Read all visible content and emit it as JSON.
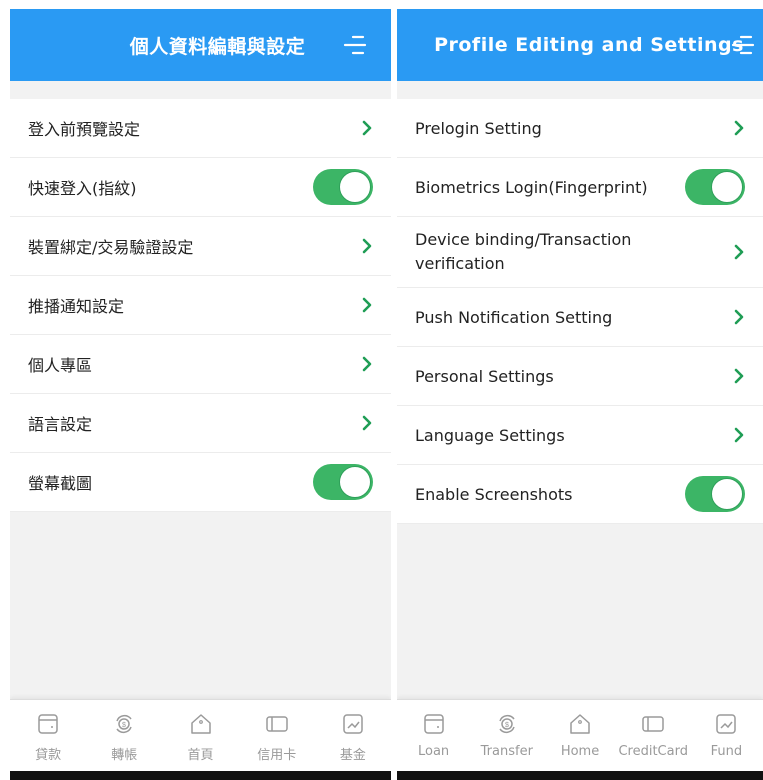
{
  "zh": {
    "header": {
      "title": "個人資料編輯與設定"
    },
    "rows": [
      {
        "label": "登入前預覽設定"
      },
      {
        "label": "快速登入(指紋)"
      },
      {
        "label": "裝置綁定/交易驗證設定"
      },
      {
        "label": "推播通知設定"
      },
      {
        "label": "個人專區"
      },
      {
        "label": "語言設定"
      },
      {
        "label": "螢幕截圖"
      }
    ],
    "tabs": [
      {
        "label": "貸款",
        "icon": "loan-icon"
      },
      {
        "label": "轉帳",
        "icon": "transfer-icon"
      },
      {
        "label": "首頁",
        "icon": "home-icon"
      },
      {
        "label": "信用卡",
        "icon": "credit-card-icon"
      },
      {
        "label": "基金",
        "icon": "fund-icon"
      }
    ]
  },
  "en": {
    "header": {
      "title": "Profile Editing and Settings"
    },
    "rows": [
      {
        "label": "Prelogin Setting"
      },
      {
        "label": "Biometrics Login(Fingerprint)"
      },
      {
        "label": "Device binding/Transaction verification"
      },
      {
        "label": "Push Notification Setting"
      },
      {
        "label": "Personal Settings"
      },
      {
        "label": "Language Settings"
      },
      {
        "label": "Enable Screenshots"
      }
    ],
    "tabs": [
      {
        "label": "Loan",
        "icon": "loan-icon"
      },
      {
        "label": "Transfer",
        "icon": "transfer-icon"
      },
      {
        "label": "Home",
        "icon": "home-icon"
      },
      {
        "label": "CreditCard",
        "icon": "credit-card-icon"
      },
      {
        "label": "Fund",
        "icon": "fund-icon"
      }
    ]
  },
  "toggles": {
    "biometrics_login": true,
    "screenshots": true
  },
  "colors": {
    "header": "#2a9af3",
    "accent_green": "#3cb566",
    "chevron": "#1f9d55",
    "tab_inactive": "#9a9a9a"
  }
}
